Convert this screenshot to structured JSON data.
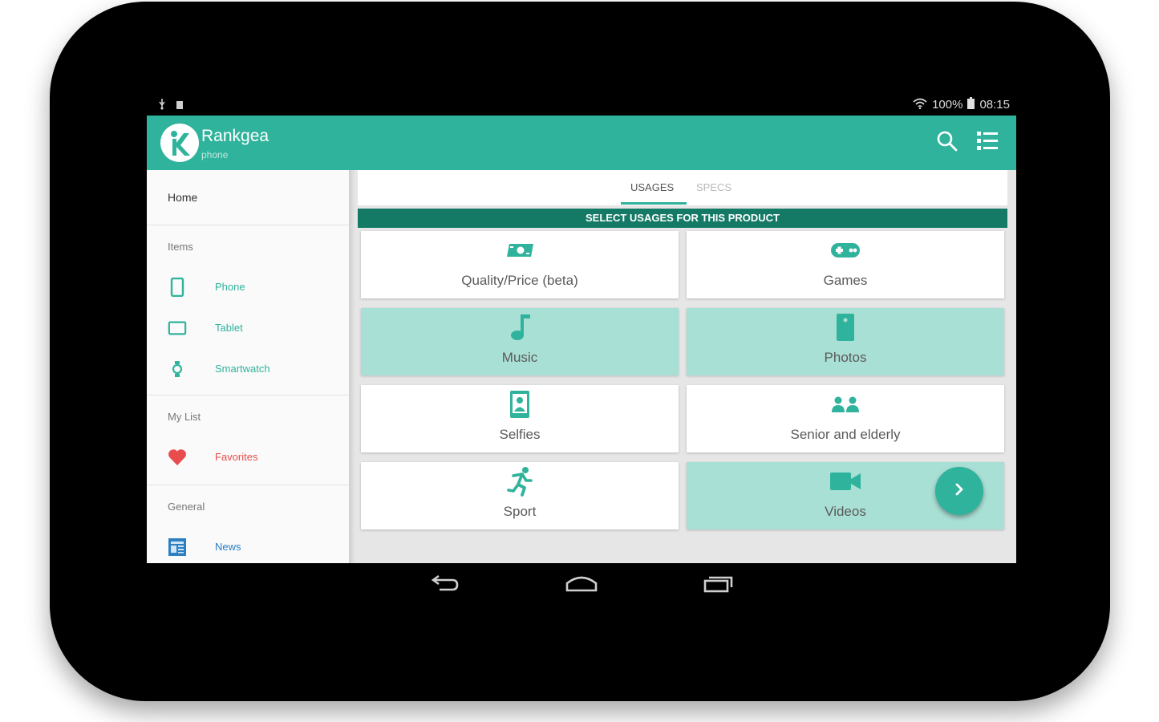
{
  "status": {
    "battery": "100%",
    "time": "08:15"
  },
  "app": {
    "title": "Rankgea",
    "subtitle": "phone"
  },
  "drawer": {
    "home": "Home",
    "sections": [
      {
        "title": "Items",
        "items": [
          {
            "label": "Phone",
            "icon": "phone-icon",
            "color": "#30b39c"
          },
          {
            "label": "Tablet",
            "icon": "tablet-icon",
            "color": "#30b39c"
          },
          {
            "label": "Smartwatch",
            "icon": "smartwatch-icon",
            "color": "#30b39c"
          }
        ]
      },
      {
        "title": "My List",
        "items": [
          {
            "label": "Favorites",
            "icon": "heart-icon",
            "color": "#e84c4c"
          }
        ]
      },
      {
        "title": "General",
        "items": [
          {
            "label": "News",
            "icon": "news-icon",
            "color": "#2c7fc1"
          }
        ]
      }
    ]
  },
  "tabs": [
    {
      "label": "USAGES",
      "selected": true
    },
    {
      "label": "SPECS",
      "selected": false
    }
  ],
  "banner": "SELECT USAGES FOR THIS PRODUCT",
  "usages": [
    {
      "label": "Quality/Price (beta)",
      "icon": "money-icon",
      "selected": false
    },
    {
      "label": "Games",
      "icon": "gamepad-icon",
      "selected": false
    },
    {
      "label": "Music",
      "icon": "music-note-icon",
      "selected": true
    },
    {
      "label": "Photos",
      "icon": "photo-icon",
      "selected": true
    },
    {
      "label": "Selfies",
      "icon": "portrait-icon",
      "selected": false
    },
    {
      "label": "Senior and elderly",
      "icon": "people-icon",
      "selected": false
    },
    {
      "label": "Sport",
      "icon": "running-icon",
      "selected": false
    },
    {
      "label": "Videos",
      "icon": "video-camera-icon",
      "selected": true
    }
  ],
  "colors": {
    "primary": "#30b39c",
    "primary_dark": "#147a66",
    "selected_card": "#a9e0d5",
    "favorite": "#e84c4c",
    "news": "#2c7fc1"
  }
}
